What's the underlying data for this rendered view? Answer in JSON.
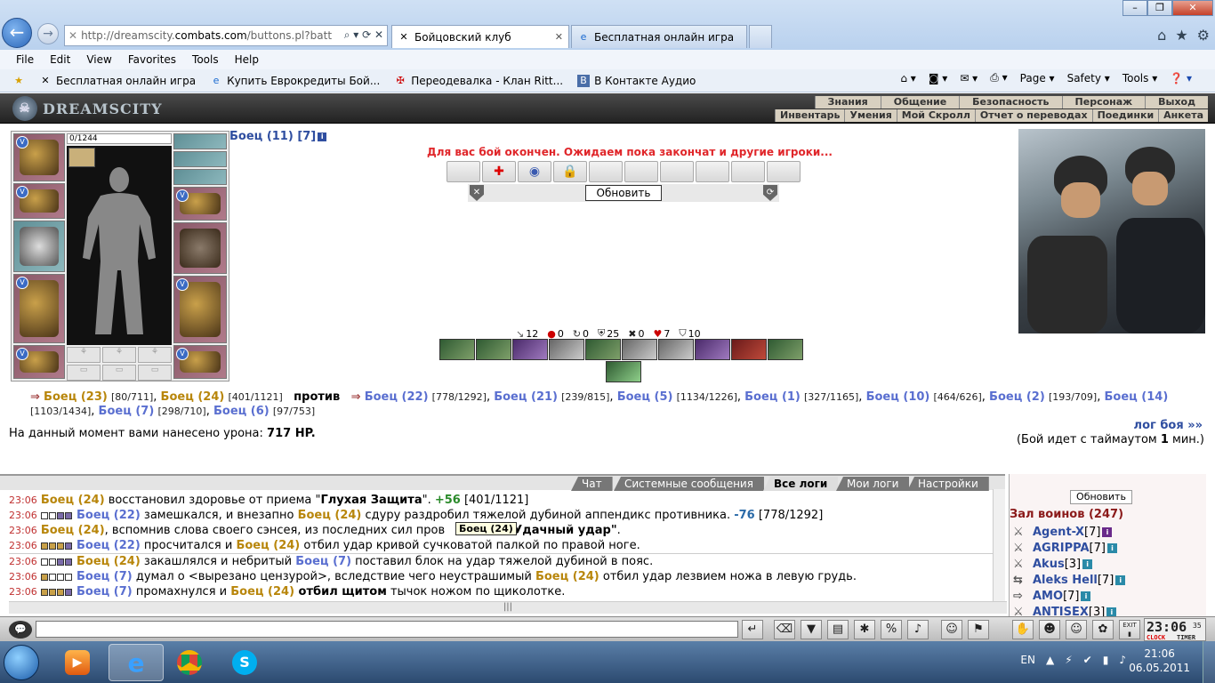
{
  "browser": {
    "url_prefix": "http://dreamscity.",
    "url_domain": "combats.com",
    "url_path": "/buttons.pl?batt",
    "tabs": [
      {
        "label": "Бойцовский клуб"
      },
      {
        "label": "Бесплатная онлайн игра"
      }
    ],
    "menu": [
      "File",
      "Edit",
      "View",
      "Favorites",
      "Tools",
      "Help"
    ],
    "favorites": [
      "Бесплатная онлайн игра",
      "Купить Еврокредиты Бой...",
      "Переодевалка - Клан Ritt...",
      "В Контакте  Аудио"
    ],
    "commands": [
      "Page",
      "Safety",
      "Tools"
    ]
  },
  "game": {
    "logo": "DREAMSCITY",
    "nav_top": [
      "Знания",
      "Общение",
      "Безопасность",
      "Персонаж",
      "Выход"
    ],
    "nav_bottom": [
      "Инвентарь",
      "Умения",
      "Мой Скролл",
      "Отчет о переводах",
      "Поединки",
      "Анкета"
    ],
    "hp": "0/1244",
    "fighter_name": "Боец (11) [7]",
    "fighter_info": "i",
    "end_message": "Для вас бой окончен. Ожидаем пока закончат и другие игроки...",
    "refresh_label": "Обновить",
    "stats": [
      {
        "icon": "↘",
        "value": "12"
      },
      {
        "icon": "●",
        "value": "0"
      },
      {
        "icon": "↻",
        "value": "0"
      },
      {
        "icon": "⛨",
        "value": "25"
      },
      {
        "icon": "✖",
        "value": "0"
      },
      {
        "icon": "♥",
        "value": "7"
      },
      {
        "icon": "⛉",
        "value": "10"
      }
    ],
    "team1": [
      {
        "name": "Боец (23)",
        "hp": "[80/711]"
      },
      {
        "name": "Боец (24)",
        "hp": "[401/1121]"
      }
    ],
    "versus": "против",
    "team2": [
      {
        "name": "Боец (22)",
        "hp": "[778/1292]"
      },
      {
        "name": "Боец (21)",
        "hp": "[239/815]"
      },
      {
        "name": "Боец (5)",
        "hp": "[1134/1226]"
      },
      {
        "name": "Боец (1)",
        "hp": "[327/1165]"
      },
      {
        "name": "Боец (10)",
        "hp": "[464/626]"
      },
      {
        "name": "Боец (2)",
        "hp": "[193/709]"
      },
      {
        "name": "Боец (14)",
        "hp": "[1103/1434]"
      },
      {
        "name": "Боец (7)",
        "hp": "[298/710]"
      },
      {
        "name": "Боец (6)",
        "hp": "[97/753]"
      }
    ],
    "damage_label": "На данный момент вами нанесено урона:",
    "damage_value": "717 HP.",
    "battle_log": "лог боя »»",
    "timeout_pre": "(Бой идет с таймаутом",
    "timeout_value": "1",
    "timeout_post": "мин.)"
  },
  "chat": {
    "tabs": [
      "Чат",
      "Системные сообщения",
      "Все логи",
      "Мои логи",
      "Настройки"
    ],
    "tooltip": "Боец (24)",
    "lines": [
      {
        "time": "23:06",
        "a": "Боец (24)",
        "t1": " восстановил здоровье от приема \"",
        "b": "Глухая Защита",
        "t2": "\". ",
        "num": "+56",
        "t3": " [401/1121]"
      },
      {
        "time": "23:06",
        "a": "Боец (22)",
        "t1": " замешкался, и внезапно ",
        "b": "Боец (24)",
        "t2": " сдуру раздробил тяжелой дубиной аппендикс противника. ",
        "num": "-76",
        "t3": " [778/1292]"
      },
      {
        "time": "23:06",
        "a": "Боец (24)",
        "t1": ", вспомнив слова своего сэнсея, из последних сил пров",
        "b": "",
        "t2": "",
        "num": "\"Удачный удар\"",
        "t3": "."
      },
      {
        "time": "23:06",
        "a": "Боец (22)",
        "t1": " просчитался и ",
        "b": "Боец (24)",
        "t2": " отбил удар кривой сучковатой палкой по правой ноге.",
        "num": "",
        "t3": ""
      },
      {
        "time": "23:06",
        "a": "Боец (24)",
        "t1": " закашлялся и небритый ",
        "b": "Боец (7)",
        "t2": " поставил блок на удар тяжелой дубиной в пояс.",
        "num": "",
        "t3": ""
      },
      {
        "time": "23:06",
        "a": "Боец (7)",
        "t1": " думал о <вырезано цензурой>, вследствие чего неустрашимый ",
        "b": "Боец (24)",
        "t2": " отбил удар лезвием ножа в левую грудь.",
        "num": "",
        "t3": ""
      },
      {
        "time": "23:06",
        "a": "Боец (7)",
        "t1": " промахнулся и ",
        "b": "Боец (24)",
        "t2": " отбил щитом",
        "num": "",
        "t3": " тычок ножом по щиколотке."
      }
    ],
    "hall_refresh": "Обновить",
    "hall_title": "Зал воинов (247)",
    "hall": [
      {
        "name": "Agent-X",
        "lv": "[7]"
      },
      {
        "name": "AGRIPPA",
        "lv": "[7]"
      },
      {
        "name": "Akus",
        "lv": "[3]"
      },
      {
        "name": "Aleks Hell",
        "lv": "[7]"
      },
      {
        "name": "AMO",
        "lv": "[7]"
      },
      {
        "name": "ANTISEX",
        "lv": "[3]"
      }
    ],
    "scroll_glyph": "|||"
  },
  "clock": {
    "time": "23:06",
    "sec": "35",
    "clock_label": "CLOCK",
    "timer_label": "TIMER",
    "exit_label": "EXIT"
  },
  "taskbar": {
    "lang": "EN",
    "time": "21:06",
    "date": "06.05.2011"
  }
}
